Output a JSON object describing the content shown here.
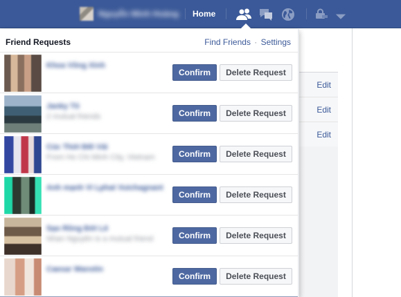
{
  "topbar": {
    "profile_name": "Nguyễn Minh Hoàng",
    "home_label": "Home",
    "icons": [
      "friends-icon",
      "messages-icon",
      "globe-icon",
      "privacy-icon",
      "chevron-down-icon"
    ],
    "color": "#3b5998"
  },
  "popup": {
    "title": "Friend Requests",
    "find_friends": "Find Friends",
    "separator": "·",
    "settings": "Settings",
    "confirm_label": "Confirm",
    "delete_label": "Delete Request",
    "requests": [
      {
        "name": "Khoa Võng Xinh",
        "subtitle": ""
      },
      {
        "name": "Janky Tô",
        "subtitle": "2 mutual friends"
      },
      {
        "name": "Cúc Thời Đết Vải",
        "subtitle": "From Ho Chi Minh City, Vietnam"
      },
      {
        "name": "Anh mạnh Vi Lphat Vuichagnant",
        "subtitle": ""
      },
      {
        "name": "Sạo Rồng Đới Lê",
        "subtitle": "Nhan Nguyễn is a mutual friend"
      },
      {
        "name": "Caesar Wanstin",
        "subtitle": ""
      }
    ]
  },
  "background": {
    "edit_labels": [
      "Edit",
      "Edit",
      "Edit"
    ]
  }
}
